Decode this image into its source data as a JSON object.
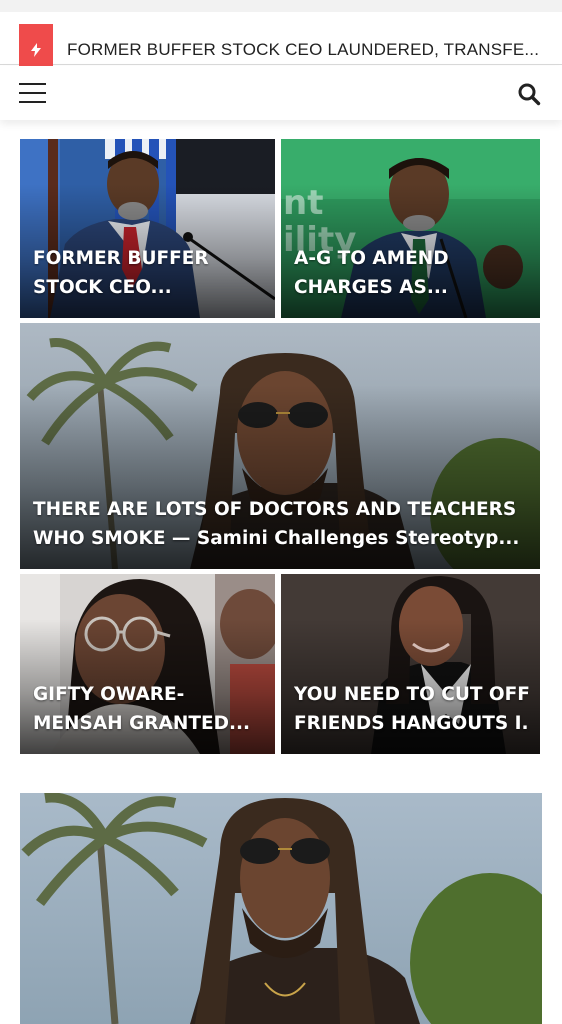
{
  "ticker": {
    "icon": "lightning-icon",
    "accent": "#ef4b4b",
    "text": "FORMER BUFFER STOCK CEO LAUNDERED, TRANSFE..."
  },
  "navbar": {
    "menu_icon": "hamburger-menu-icon",
    "search_icon": "search-icon"
  },
  "articles": [
    {
      "line1": "FORMER BUFFER",
      "line2": "STOCK CEO..."
    },
    {
      "line1": "A-G TO AMEND",
      "line2": "CHARGES AS..."
    },
    {
      "line1": "THERE ARE LOTS OF DOCTORS AND TEACHERS",
      "line2": "WHO SMOKE — Samini Challenges Stereotyp..."
    },
    {
      "line1": "GIFTY OWARE-",
      "line2": "MENSAH GRANTED..."
    },
    {
      "line1": "YOU NEED TO CUT OFF",
      "line2": "FRIENDS HANGOUTS I..."
    }
  ]
}
